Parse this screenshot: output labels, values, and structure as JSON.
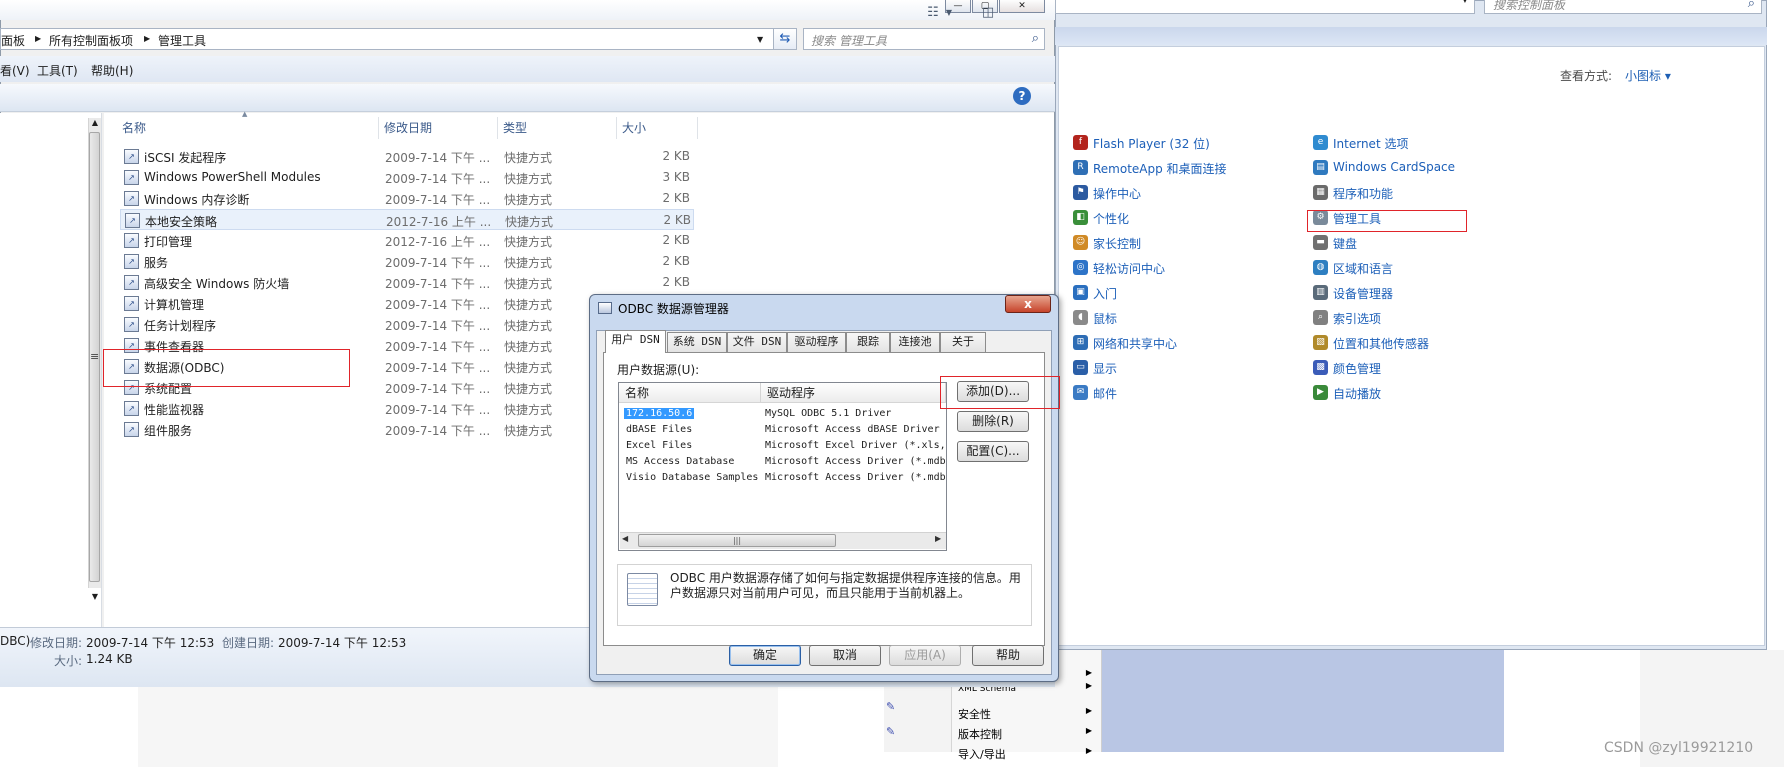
{
  "explorer": {
    "breadcrumb": [
      "面板",
      "所有控制面板项",
      "管理工具"
    ],
    "search_placeholder": "搜索 管理工具",
    "menu": [
      "看(V)",
      "工具(T)",
      "帮助(H)"
    ],
    "columns": [
      "名称",
      "修改日期",
      "类型",
      "大小"
    ],
    "files": [
      {
        "name": "iSCSI 发起程序",
        "date": "2009-7-14 下午 ...",
        "type": "快捷方式",
        "size": "2 KB"
      },
      {
        "name": "Windows PowerShell Modules",
        "date": "2009-7-14 下午 ...",
        "type": "快捷方式",
        "size": "3 KB"
      },
      {
        "name": "Windows 内存诊断",
        "date": "2009-7-14 下午 ...",
        "type": "快捷方式",
        "size": "2 KB"
      },
      {
        "name": "本地安全策略",
        "date": "2012-7-16 上午 ...",
        "type": "快捷方式",
        "size": "2 KB"
      },
      {
        "name": "打印管理",
        "date": "2012-7-16 上午 ...",
        "type": "快捷方式",
        "size": "2 KB"
      },
      {
        "name": "服务",
        "date": "2009-7-14 下午 ...",
        "type": "快捷方式",
        "size": "2 KB"
      },
      {
        "name": "高级安全 Windows 防火墙",
        "date": "2009-7-14 下午 ...",
        "type": "快捷方式",
        "size": "2 KB"
      },
      {
        "name": "计算机管理",
        "date": "2009-7-14 下午 ...",
        "type": "快捷方式",
        "size": ""
      },
      {
        "name": "任务计划程序",
        "date": "2009-7-14 下午 ...",
        "type": "快捷方式",
        "size": ""
      },
      {
        "name": "事件查看器",
        "date": "2009-7-14 下午 ...",
        "type": "快捷方式",
        "size": ""
      },
      {
        "name": "数据源(ODBC)",
        "date": "2009-7-14 下午 ...",
        "type": "快捷方式",
        "size": ""
      },
      {
        "name": "系统配置",
        "date": "2009-7-14 下午 ...",
        "type": "快捷方式",
        "size": ""
      },
      {
        "name": "性能监视器",
        "date": "2009-7-14 下午 ...",
        "type": "快捷方式",
        "size": ""
      },
      {
        "name": "组件服务",
        "date": "2009-7-14 下午 ...",
        "type": "快捷方式",
        "size": ""
      }
    ],
    "status": {
      "item_name": "DBC)",
      "modified_label": "修改日期:",
      "modified_value": "2009-7-14 下午 12:53",
      "created_label": "创建日期:",
      "created_value": "2009-7-14 下午 12:53",
      "size_label": "大小:",
      "size_value": "1.24 KB"
    }
  },
  "control_panel": {
    "search_placeholder": "搜索控制面板",
    "view_by_label": "查看方式:",
    "view_by_value": "小图标 ▾",
    "col1": [
      {
        "label": "Flash Player (32 位)",
        "color": "#b3241d",
        "glyph": "f"
      },
      {
        "label": "RemoteApp 和桌面连接",
        "color": "#2f6fb5",
        "glyph": "R"
      },
      {
        "label": "操作中心",
        "color": "#2c5aa0",
        "glyph": "⚑"
      },
      {
        "label": "个性化",
        "color": "#3a8f3a",
        "glyph": "◧"
      },
      {
        "label": "家长控制",
        "color": "#d08a26",
        "glyph": "☺"
      },
      {
        "label": "轻松访问中心",
        "color": "#2e74c8",
        "glyph": "◎"
      },
      {
        "label": "入门",
        "color": "#2a6fbf",
        "glyph": "▣"
      },
      {
        "label": "鼠标",
        "color": "#8a8a8a",
        "glyph": "◖"
      },
      {
        "label": "网络和共享中心",
        "color": "#2e6db5",
        "glyph": "⊞"
      },
      {
        "label": "显示",
        "color": "#2b5fa8",
        "glyph": "▭"
      },
      {
        "label": "邮件",
        "color": "#3b7bc4",
        "glyph": "✉"
      }
    ],
    "col2": [
      {
        "label": "Internet 选项",
        "color": "#2f8bd0",
        "glyph": "e"
      },
      {
        "label": "Windows CardSpace",
        "color": "#2f7abf",
        "glyph": "▤"
      },
      {
        "label": "程序和功能",
        "color": "#6b6b6b",
        "glyph": "▦"
      },
      {
        "label": "管理工具",
        "color": "#7a8a9a",
        "glyph": "⚙"
      },
      {
        "label": "键盘",
        "color": "#707070",
        "glyph": "▬"
      },
      {
        "label": "区域和语言",
        "color": "#2e7fc1",
        "glyph": "◍"
      },
      {
        "label": "设备管理器",
        "color": "#5a6b7a",
        "glyph": "▥"
      },
      {
        "label": "索引选项",
        "color": "#808080",
        "glyph": "⌕"
      },
      {
        "label": "位置和其他传感器",
        "color": "#b08a2a",
        "glyph": "▧"
      },
      {
        "label": "颜色管理",
        "color": "#3b5cb8",
        "glyph": "▩"
      },
      {
        "label": "自动播放",
        "color": "#3a8a3a",
        "glyph": "▶"
      }
    ]
  },
  "dialog": {
    "title": "ODBC 数据源管理器",
    "close": "x",
    "tabs": [
      "用户 DSN",
      "系统 DSN",
      "文件 DSN",
      "驱动程序",
      "跟踪",
      "连接池",
      "关于"
    ],
    "list_label": "用户数据源(U):",
    "list_headers": [
      "名称",
      "驱动程序"
    ],
    "dsn_rows": [
      {
        "name": "172.16.50.6",
        "driver": "MySQL ODBC 5.1 Driver"
      },
      {
        "name": "dBASE Files",
        "driver": "Microsoft Access dBASE Driver"
      },
      {
        "name": "Excel Files",
        "driver": "Microsoft Excel Driver (*.xls,"
      },
      {
        "name": "MS Access Database",
        "driver": "Microsoft Access Driver (*.mdb"
      },
      {
        "name": "Visio Database Samples",
        "driver": "Microsoft Access Driver (*.mdb"
      }
    ],
    "scroll_grip": "|||",
    "buttons": {
      "add": "添加(D)...",
      "remove": "删除(R)",
      "configure": "配置(C)..."
    },
    "info": "ODBC 用户数据源存储了如何与指定数据提供程序连接的信息。用户数据源只对当前用户可见，而且只能用于当前机器上。",
    "footer": {
      "ok": "确定",
      "cancel": "取消",
      "apply": "应用(A)",
      "help": "帮助"
    }
  },
  "background_menu": [
    "XML Schema",
    "安全性",
    "版本控制",
    "导入/导出"
  ],
  "watermark": "CSDN @zyl19921210"
}
